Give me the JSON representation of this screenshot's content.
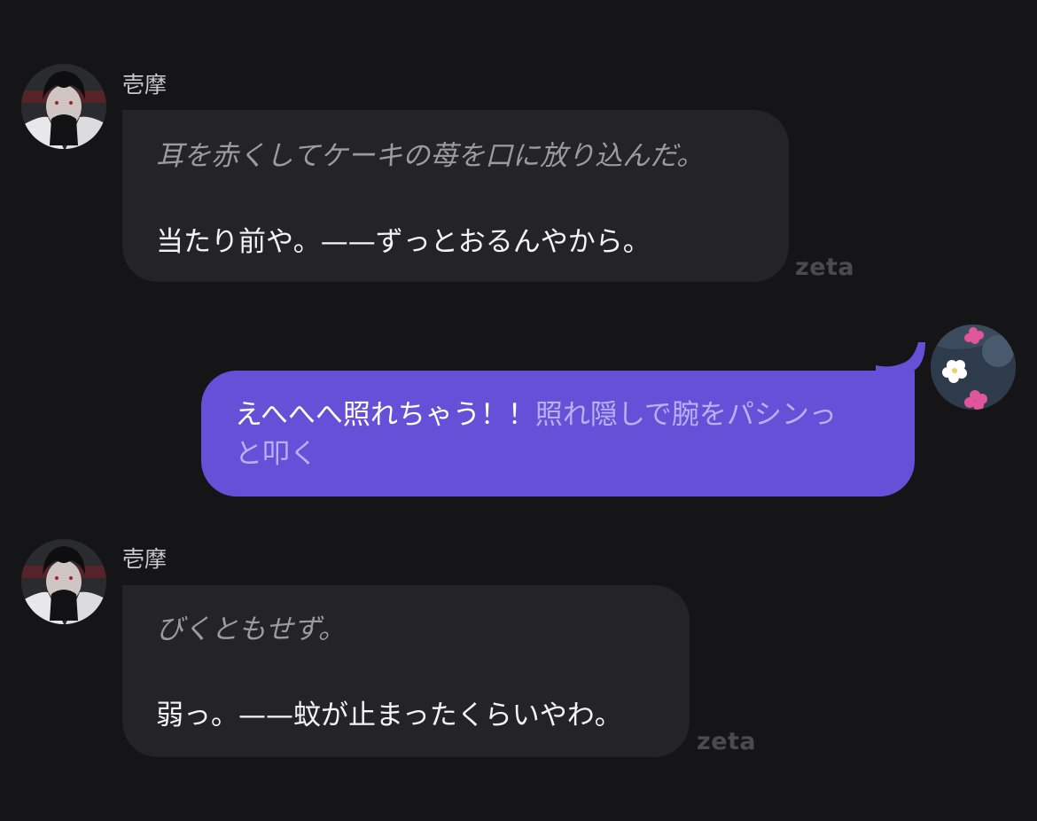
{
  "messages": [
    {
      "sender": "壱摩",
      "narration": "耳を赤くしてケーキの苺を口に放り込んだ。",
      "speech": "当たり前や。——ずっとおるんやから。",
      "watermark": "zeta"
    },
    {
      "speech": "えへへへ照れちゃう！！",
      "action_line1": "照れ隠しで腕をパシンっ",
      "action_line2": "と叩く"
    },
    {
      "sender": "壱摩",
      "narration": "びくともせず。",
      "speech": "弱っ。——蚊が止まったくらいやわ。",
      "watermark": "zeta"
    }
  ],
  "colors": {
    "background": "#151517",
    "bot_bubble": "#242427",
    "user_bubble": "#6650d8",
    "narration_text": "#9b9ba0",
    "watermark": "#4a4a4f"
  }
}
